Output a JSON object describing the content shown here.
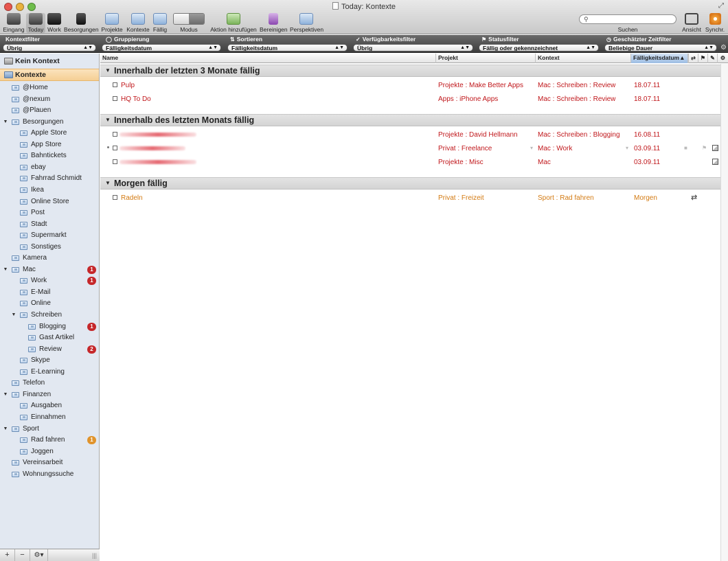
{
  "window": {
    "title": "Today: Kontexte"
  },
  "toolbar": {
    "items": [
      {
        "label": "Eingang",
        "icon": "inbox-tray-icon"
      },
      {
        "label": "Today",
        "icon": "calendar-icon"
      },
      {
        "label": "Work",
        "icon": "briefcase-icon"
      },
      {
        "label": "Besorgungen",
        "icon": "shopping-bag-icon"
      },
      {
        "label": "Projekte",
        "icon": "projects-icon"
      },
      {
        "label": "Kontexte",
        "icon": "contexts-icon"
      },
      {
        "label": "Fällig",
        "icon": "due-icon"
      },
      {
        "label": "Modus",
        "icon": "mode-segment-icon"
      },
      {
        "label": "Aktion hinzufügen",
        "icon": "add-action-icon"
      },
      {
        "label": "Bereinigen",
        "icon": "broom-icon"
      },
      {
        "label": "Perspektiven",
        "icon": "perspectives-icon"
      }
    ],
    "search": {
      "label": "Suchen",
      "value": ""
    },
    "view_label": "Ansicht",
    "sync_label": "Synchr."
  },
  "filters": [
    {
      "label": "Kontextfilter",
      "value": "Übrig",
      "icon": ""
    },
    {
      "label": "Gruppierung",
      "value": "Fälligkeitsdatum",
      "icon": "group-icon"
    },
    {
      "label": "Sortieren",
      "value": "Fälligkeitsdatum",
      "icon": "sort-icon"
    },
    {
      "label": "Verfügbarkeitsfilter",
      "value": "Übrig",
      "icon": "check-icon"
    },
    {
      "label": "Statusfilter",
      "value": "Fällig oder gekennzeichnet",
      "icon": "flag-icon"
    },
    {
      "label": "Geschätzter Zeitfilter",
      "value": "Beliebige Dauer",
      "icon": "clock-icon"
    }
  ],
  "sidebar": {
    "no_context": "Kein Kontext",
    "contexts_root": "Kontexte",
    "items": [
      {
        "label": "@Home",
        "level": 1,
        "badge": ""
      },
      {
        "label": "@nexum",
        "level": 1,
        "badge": ""
      },
      {
        "label": "@Plauen",
        "level": 1,
        "badge": ""
      },
      {
        "label": "Besorgungen",
        "level": 1,
        "badge": "",
        "expanded": true
      },
      {
        "label": "Apple Store",
        "level": 2,
        "badge": ""
      },
      {
        "label": "App Store",
        "level": 2,
        "badge": ""
      },
      {
        "label": "Bahntickets",
        "level": 2,
        "badge": ""
      },
      {
        "label": "ebay",
        "level": 2,
        "badge": ""
      },
      {
        "label": "Fahrrad Schmidt",
        "level": 2,
        "badge": ""
      },
      {
        "label": "Ikea",
        "level": 2,
        "badge": ""
      },
      {
        "label": "Online Store",
        "level": 2,
        "badge": ""
      },
      {
        "label": "Post",
        "level": 2,
        "badge": ""
      },
      {
        "label": "Stadt",
        "level": 2,
        "badge": ""
      },
      {
        "label": "Supermarkt",
        "level": 2,
        "badge": ""
      },
      {
        "label": "Sonstiges",
        "level": 2,
        "badge": ""
      },
      {
        "label": "Kamera",
        "level": 1,
        "badge": ""
      },
      {
        "label": "Mac",
        "level": 1,
        "badge": "1",
        "badge_color": "red",
        "expanded": true
      },
      {
        "label": "Work",
        "level": 2,
        "badge": "1",
        "badge_color": "red"
      },
      {
        "label": "E-Mail",
        "level": 2,
        "badge": ""
      },
      {
        "label": "Online",
        "level": 2,
        "badge": ""
      },
      {
        "label": "Schreiben",
        "level": 2,
        "badge": "",
        "expanded": true
      },
      {
        "label": "Blogging",
        "level": 3,
        "badge": "1",
        "badge_color": "red"
      },
      {
        "label": "Gast Artikel",
        "level": 3,
        "badge": ""
      },
      {
        "label": "Review",
        "level": 3,
        "badge": "2",
        "badge_color": "red"
      },
      {
        "label": "Skype",
        "level": 2,
        "badge": ""
      },
      {
        "label": "E-Learning",
        "level": 2,
        "badge": ""
      },
      {
        "label": "Telefon",
        "level": 1,
        "badge": ""
      },
      {
        "label": "Finanzen",
        "level": 1,
        "badge": "",
        "expanded": true
      },
      {
        "label": "Ausgaben",
        "level": 2,
        "badge": ""
      },
      {
        "label": "Einnahmen",
        "level": 2,
        "badge": ""
      },
      {
        "label": "Sport",
        "level": 1,
        "badge": "",
        "expanded": true
      },
      {
        "label": "Rad fahren",
        "level": 2,
        "badge": "1",
        "badge_color": "orange"
      },
      {
        "label": "Joggen",
        "level": 2,
        "badge": ""
      },
      {
        "label": "Vereinsarbeit",
        "level": 1,
        "badge": ""
      },
      {
        "label": "Wohnungssuche",
        "level": 1,
        "badge": ""
      }
    ],
    "bottom": {
      "add": "+",
      "remove": "−",
      "gear": "⚙▾"
    }
  },
  "columns": {
    "name": "Name",
    "project": "Projekt",
    "context": "Kontext",
    "due": "Fälligkeitsdatum"
  },
  "groups": [
    {
      "title": "Innerhalb der letzten 3 Monate fällig",
      "tasks": [
        {
          "name": "Pulp",
          "project": "Projekte : Make Better Apps",
          "context": "Mac : Schreiben : Review",
          "due": "18.07.11",
          "color": "red"
        },
        {
          "name": "HQ To Do",
          "project": "Apps : iPhone Apps",
          "context": "Mac : Schreiben : Review",
          "due": "18.07.11",
          "color": "red"
        }
      ]
    },
    {
      "title": "Innerhalb des letzten Monats fällig",
      "tasks": [
        {
          "name": "",
          "redacted": true,
          "project": "Projekte : David Hellmann",
          "context": "Mac : Schreiben : Blogging",
          "due": "16.08.11",
          "color": "red"
        },
        {
          "name": "",
          "redacted": true,
          "project": "Privat : Freelance",
          "context": "Mac : Work",
          "due": "03.09.11",
          "color": "red",
          "note": true,
          "bullet": true
        },
        {
          "name": "",
          "redacted": true,
          "project": "Projekte : Misc",
          "context": "Mac",
          "due": "03.09.11",
          "color": "red",
          "note": true
        }
      ]
    },
    {
      "title": "Morgen fällig",
      "tasks": [
        {
          "name": "Radeln",
          "project": "Privat : Freizeit",
          "context": "Sport : Rad fahren",
          "due": "Morgen",
          "color": "orange",
          "repeat": true
        }
      ]
    }
  ]
}
